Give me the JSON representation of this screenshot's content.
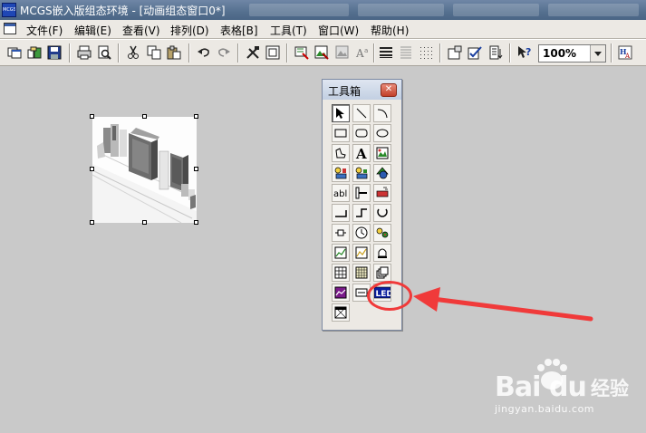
{
  "window": {
    "title": "MCGS嵌入版组态环境 - [动画组态窗口0*]",
    "app_icon_text": "MCGS"
  },
  "menubar": {
    "items": [
      {
        "label": "文件(F)"
      },
      {
        "label": "编辑(E)"
      },
      {
        "label": "查看(V)"
      },
      {
        "label": "排列(D)"
      },
      {
        "label": "表格[B]"
      },
      {
        "label": "工具(T)"
      },
      {
        "label": "窗口(W)"
      },
      {
        "label": "帮助(H)"
      }
    ]
  },
  "toolbar": {
    "zoom_value": "100%",
    "icons": [
      "new-window-icon",
      "open-icon",
      "save-icon",
      "print-icon",
      "print-preview-icon",
      "cut-icon",
      "copy-icon",
      "paste-icon",
      "undo-icon",
      "redo-icon",
      "tools-icon",
      "frame-icon",
      "data-icon",
      "image-icon",
      "text-size-icon",
      "align-icon",
      "list-icon",
      "grid-icon",
      "properties-icon",
      "check-icon",
      "download-icon",
      "help-icon",
      "font-icon"
    ]
  },
  "toolbox": {
    "title": "工具箱",
    "text_tool_label": "abl",
    "letter_tool_label": "A",
    "led_tool_label": "LED",
    "tools": [
      "pointer",
      "line",
      "arc",
      "rectangle",
      "rounded-rectangle",
      "ellipse",
      "polygon",
      "label",
      "bitmap",
      "element",
      "component",
      "flow",
      "input-box",
      "slider",
      "button",
      "pipe",
      "polyline",
      "gauge",
      "plug",
      "clock",
      "switch",
      "trend",
      "curve",
      "alarm",
      "table",
      "grid-table",
      "layer",
      "chart",
      "text-box",
      "led",
      "template"
    ]
  },
  "watermark": {
    "brand": "Bai",
    "brand_suffix": "du",
    "cn_text": "经验",
    "url": "jingyan.baidu.com"
  },
  "colors": {
    "canvas": "#c9c9c9",
    "annotation": "#f03a3a",
    "titlebar": "#55708f"
  }
}
